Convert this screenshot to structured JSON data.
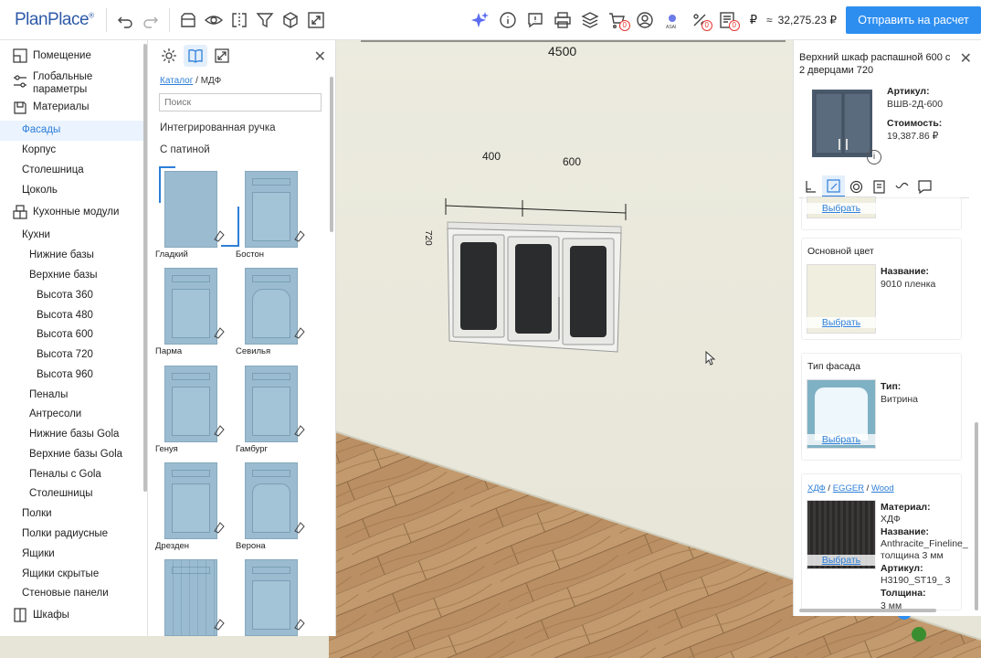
{
  "topbar": {
    "logo": "PlanPlace",
    "logo_mark": "®",
    "left_icons": [
      "undo-icon",
      "redo-icon",
      "save-icon",
      "view-icon",
      "mirror-icon",
      "filter-icon",
      "cube-icon",
      "fullscreen-icon"
    ],
    "right_icons": [
      "ai-sparkle-icon",
      "info-icon",
      "comment-icon",
      "print-icon",
      "layers-icon",
      "cart-icon",
      "user-icon",
      "asai-icon",
      "discount-icon",
      "list-icon"
    ],
    "badges": [
      "0",
      "0",
      "0"
    ],
    "currency_symbol": "₽",
    "approx": "≈",
    "total": "32,275.23 ₽",
    "send_label": "Отправить на расчет"
  },
  "scene": {
    "wall_width": "4500",
    "dim_left": "400",
    "dim_right": "600",
    "dim_height": "720"
  },
  "leftnav": {
    "sections": [
      {
        "label": "Помещение",
        "icon": "room-icon"
      },
      {
        "label": "Глобальные параметры",
        "icon": "sliders-icon"
      },
      {
        "label": "Материалы",
        "icon": "materials-icon"
      },
      {
        "label": "Кухонные модули",
        "icon": "modules-icon"
      },
      {
        "label": "Шкафы",
        "icon": "wardrobe-icon"
      }
    ],
    "materials_items": [
      "Фасады",
      "Корпус",
      "Столешница",
      "Цоколь"
    ],
    "selected": "Фасады",
    "modules_items": [
      "Кухни",
      "Нижние базы",
      "Верхние базы",
      "Высота 360",
      "Высота 480",
      "Высота 600",
      "Высота 720",
      "Высота 960",
      "Пеналы",
      "Антресоли",
      "Нижние базы Gola",
      "Верхние базы Gola",
      "Пеналы с Gola",
      "Столешницы",
      "Полки",
      "Полки радиусные",
      "Ящики",
      "Ящики скрытые",
      "Стеновые панели"
    ]
  },
  "catalog": {
    "crumb_link": "Каталог",
    "crumb_sep": "/",
    "crumb_current": "МДФ",
    "search_placeholder": "Поиск",
    "group1": "Интегрированная ручка",
    "group2": "С патиной",
    "tiles": [
      "Гладкий",
      "Бостон",
      "Парма",
      "Севилья",
      "Генуя",
      "Гамбург",
      "Дрезден",
      "Верона",
      "",
      ""
    ]
  },
  "props": {
    "title": "Верхний шкаф распашной 600 с 2 дверцами 720",
    "article_label": "Артикул:",
    "article_value": "ВШВ-2Д-600",
    "cost_label": "Стоимость:",
    "cost_value": "19,387.86 ₽",
    "tabs": [
      "leg-icon",
      "facade-icon",
      "circle-icon",
      "doc-icon",
      "handle-icon",
      "comment-icon"
    ],
    "choose_label": "Выбрать",
    "base_color_title": "Основной цвет",
    "name_label": "Название:",
    "base_color_name": "9010 пленка",
    "facade_type_title": "Тип фасада",
    "type_label": "Тип:",
    "facade_type_value": "Витрина",
    "material_path": [
      "ХДФ",
      "EGGER",
      "Wood"
    ],
    "material_label": "Материал:",
    "material_value": "ХДФ",
    "material_name_value": "Anthracite_Fineline_",
    "material_name_value2": "толщина 3 мм",
    "article2_label": "Артикул:",
    "article2_value": "H3190_ST19_ 3",
    "thickness_label": "Толщина:",
    "thickness_value": "3 мм"
  },
  "colors": {
    "accent": "#2d8ef0",
    "link": "#2d7fd8",
    "door": "#9bbcd0",
    "floor": "#b58a5e"
  }
}
